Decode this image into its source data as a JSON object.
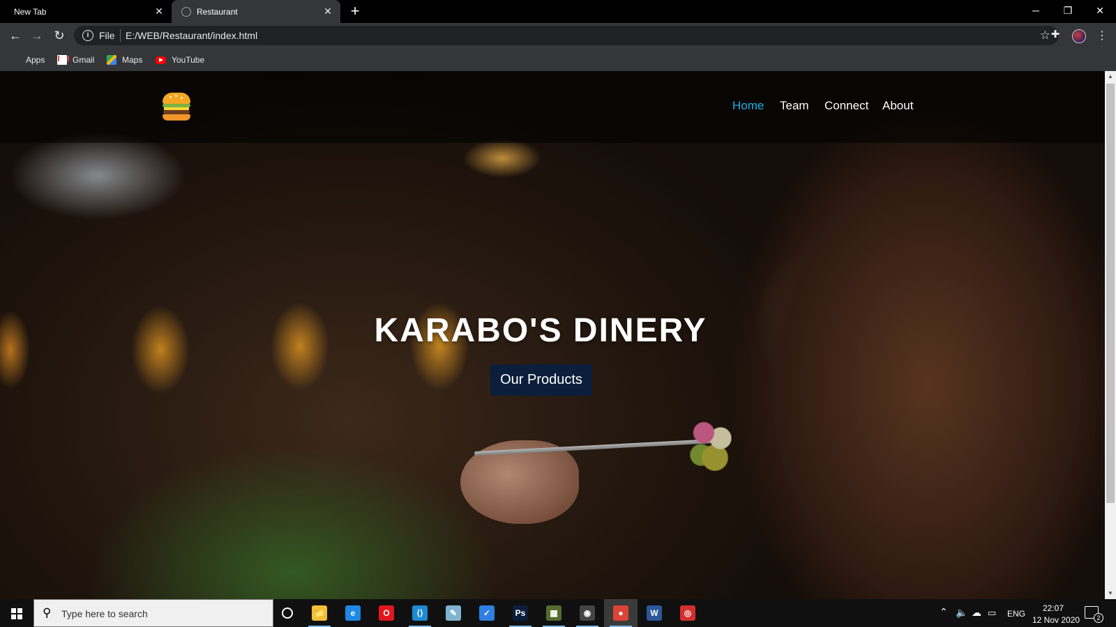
{
  "browser": {
    "tabs": [
      {
        "title": "New Tab",
        "active": false
      },
      {
        "title": "Restaurant",
        "active": true
      }
    ],
    "new_tab_label": "+",
    "url_scheme": "File",
    "url": "E:/WEB/Restaurant/index.html",
    "bookmarks": [
      {
        "label": "Apps",
        "icon": "apps-grid-icon"
      },
      {
        "label": "Gmail",
        "icon": "gmail-icon"
      },
      {
        "label": "Maps",
        "icon": "maps-icon"
      },
      {
        "label": "YouTube",
        "icon": "youtube-icon"
      }
    ]
  },
  "page": {
    "logo_icon": "burger-icon",
    "nav": [
      {
        "label": "Home",
        "active": true
      },
      {
        "label": "Team",
        "active": false
      },
      {
        "label": "Connect",
        "active": false
      },
      {
        "label": "About",
        "active": false
      }
    ],
    "hero_title": "KARABO'S DINERY",
    "cta_label": "Our Products",
    "colors": {
      "nav_active": "#17b3e6",
      "cta_background": "#0b1e3c"
    }
  },
  "taskbar": {
    "search_placeholder": "Type here to search",
    "apps": [
      {
        "name": "file-explorer",
        "glyph": "📁",
        "color": "#f2c037"
      },
      {
        "name": "edge",
        "glyph": "e",
        "color": "#1e88e5"
      },
      {
        "name": "opera",
        "glyph": "O",
        "color": "#e0171f"
      },
      {
        "name": "vscode",
        "glyph": "⟨⟩",
        "color": "#1f8ad2"
      },
      {
        "name": "notepad",
        "glyph": "✎",
        "color": "#7fb4cf"
      },
      {
        "name": "todo",
        "glyph": "✓",
        "color": "#2f7fe0"
      },
      {
        "name": "photoshop",
        "glyph": "Ps",
        "color": "#0b1d3a"
      },
      {
        "name": "photos",
        "glyph": "▦",
        "color": "#556b2f"
      },
      {
        "name": "media",
        "glyph": "◉",
        "color": "#444"
      },
      {
        "name": "chrome",
        "glyph": "●",
        "color": "#db4437"
      },
      {
        "name": "word",
        "glyph": "W",
        "color": "#2b579a"
      },
      {
        "name": "recorder",
        "glyph": "◎",
        "color": "#d32f2f"
      }
    ],
    "language": "ENG",
    "time": "22:07",
    "date": "12 Nov 2020",
    "notification_count": "2"
  }
}
